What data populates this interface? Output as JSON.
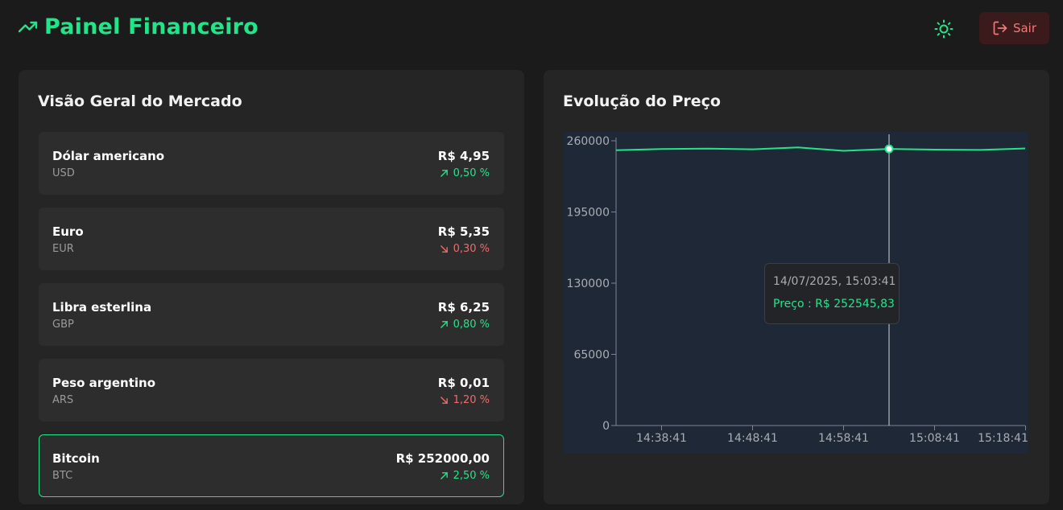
{
  "header": {
    "title": "Painel Financeiro",
    "logout_label": "Sair"
  },
  "colors": {
    "accent": "#22e58a",
    "negative": "#f06a6a",
    "background": "#1b1b1b",
    "panel": "#252525",
    "chart_bg": "#1f2837"
  },
  "icons": {
    "brand": "trending-up-icon",
    "theme": "sun-icon",
    "logout": "log-out-icon",
    "up": "arrow-up-right-icon",
    "down": "arrow-down-right-icon"
  },
  "market": {
    "title": "Visão Geral do Mercado",
    "items": [
      {
        "name": "Dólar americano",
        "code": "USD",
        "price": "R$ 4,95",
        "change": "0,50 %",
        "direction": "up",
        "selected": false
      },
      {
        "name": "Euro",
        "code": "EUR",
        "price": "R$ 5,35",
        "change": "0,30 %",
        "direction": "down",
        "selected": false
      },
      {
        "name": "Libra esterlina",
        "code": "GBP",
        "price": "R$ 6,25",
        "change": "0,80 %",
        "direction": "up",
        "selected": false
      },
      {
        "name": "Peso argentino",
        "code": "ARS",
        "price": "R$ 0,01",
        "change": "1,20 %",
        "direction": "down",
        "selected": false
      },
      {
        "name": "Bitcoin",
        "code": "BTC",
        "price": "R$ 252000,00",
        "change": "2,50 %",
        "direction": "up",
        "selected": true
      }
    ]
  },
  "price_chart": {
    "title": "Evolução do Preço",
    "tooltip": {
      "date": "14/07/2025, 15:03:41",
      "label": "Preço : R$ 252545,83"
    }
  },
  "chart_data": {
    "type": "line",
    "title": "Evolução do Preço",
    "xlabel": "",
    "ylabel": "",
    "x_ticks": [
      "14:38:41",
      "14:48:41",
      "14:58:41",
      "15:08:41",
      "15:18:41"
    ],
    "y_ticks": [
      0,
      65000,
      130000,
      195000,
      260000
    ],
    "ylim": [
      0,
      260000
    ],
    "grid": false,
    "series": [
      {
        "values": [
          {
            "x": "14:33:41",
            "y": 251300
          },
          {
            "x": "14:38:41",
            "y": 252400
          },
          {
            "x": "14:43:41",
            "y": 252900
          },
          {
            "x": "14:48:41",
            "y": 252200
          },
          {
            "x": "14:53:41",
            "y": 253900
          },
          {
            "x": "14:58:41",
            "y": 250800
          },
          {
            "x": "15:03:41",
            "y": 252545.83
          },
          {
            "x": "15:08:41",
            "y": 251900
          },
          {
            "x": "15:13:41",
            "y": 251600
          },
          {
            "x": "15:18:41",
            "y": 253000
          }
        ]
      }
    ],
    "active_point": {
      "x": "15:03:41",
      "y": 252545.83
    }
  }
}
